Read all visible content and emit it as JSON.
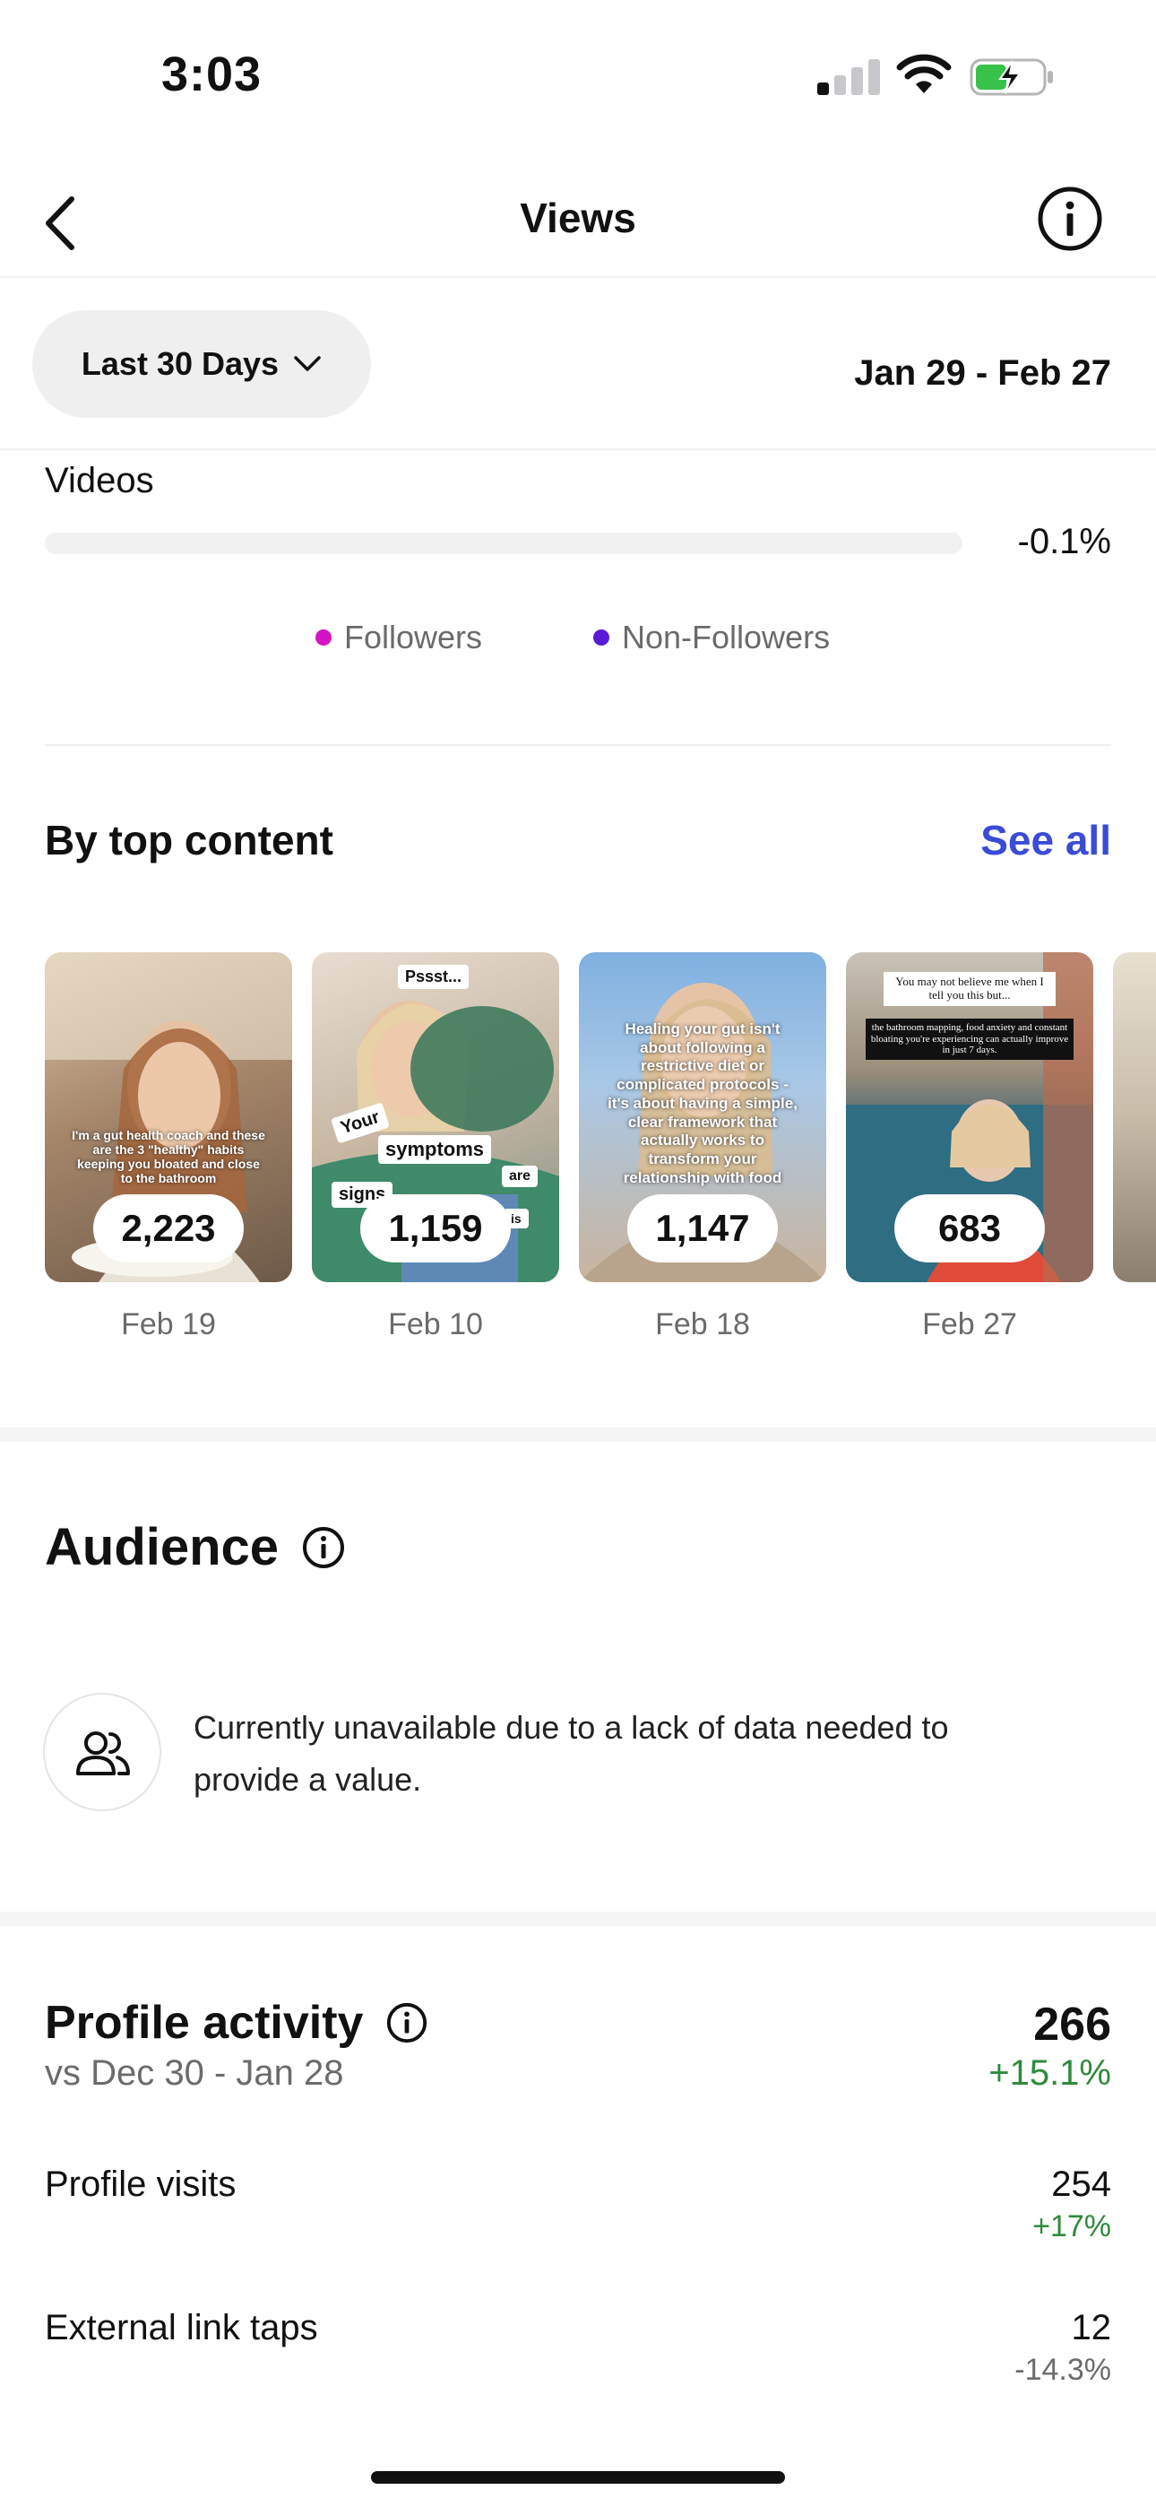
{
  "status_bar": {
    "time": "3:03"
  },
  "header": {
    "title": "Views"
  },
  "filter": {
    "range_label": "Last 30 Days",
    "date_range": "Jan 29 - Feb 27"
  },
  "videos": {
    "label": "Videos",
    "change": "-0.1%"
  },
  "legend": [
    {
      "label": "Followers",
      "color": "#d414c4"
    },
    {
      "label": "Non-Followers",
      "color": "#5a1ad6"
    }
  ],
  "top_content": {
    "title": "By top content",
    "see_all": "See all",
    "items": [
      {
        "views": "2,223",
        "date": "Feb 19",
        "overlay": "I'm a gut health coach and these are the 3 \"healthy\" habits keeping you bloated and close to the bathroom"
      },
      {
        "views": "1,159",
        "date": "Feb 10",
        "tags": [
          "Pssst...",
          "Your",
          "symptoms",
          "are",
          "signs",
          "is"
        ]
      },
      {
        "views": "1,147",
        "date": "Feb 18",
        "overlay": "Healing your gut isn't about following a restrictive diet or complicated protocols - it's about having a simple, clear framework that actually works to transform your relationship with food"
      },
      {
        "views": "683",
        "date": "Feb 27",
        "overlay_top": "You may not believe me when I tell you this but...",
        "overlay_mid": "the bathroom mapping, food anxiety and constant bloating you're experiencing can actually improve in just 7 days."
      }
    ]
  },
  "audience": {
    "title": "Audience",
    "message": "Currently unavailable due to a lack of data needed to provide a value."
  },
  "profile_activity": {
    "title": "Profile activity",
    "comparison": "vs Dec 30 - Jan 28",
    "total": "266",
    "total_change": "+15.1%",
    "rows": [
      {
        "label": "Profile visits",
        "value": "254",
        "change": "+17%"
      },
      {
        "label": "External link taps",
        "value": "12",
        "change": "-14.3%"
      }
    ]
  },
  "colors": {
    "accent": "#3a4bd8",
    "positive": "#2f8a3c",
    "negative": "#6b6b6b"
  }
}
